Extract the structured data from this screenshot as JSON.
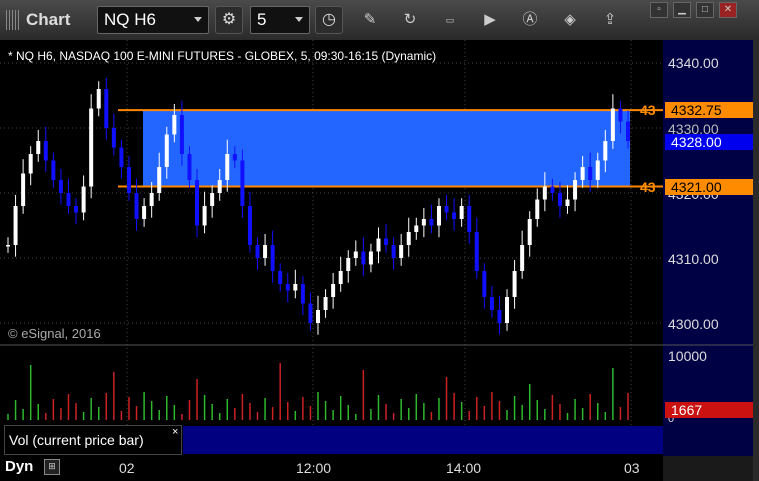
{
  "toolbar": {
    "title": "Chart",
    "symbol": "NQ H6",
    "interval": "5"
  },
  "chart_header": "* NQ H6, NASDAQ 100 E-MINI FUTURES - GLOBEX, 5, 09:30-16:15 (Dynamic)",
  "copyright": "© eSignal, 2016",
  "price_axis": {
    "ticks": [
      "4340.00",
      "4330.00",
      "4320.00",
      "4310.00",
      "4300.00"
    ],
    "hidden_tick": "4330.00"
  },
  "flags": {
    "upper_label": "4332.75",
    "current_label": "4328.00",
    "lower_label": "4321.00",
    "upper_marker": "43",
    "lower_marker": "43"
  },
  "volume_axis": {
    "tick_top": "10000",
    "tick_zero": "0",
    "current_label": "1667"
  },
  "volume_study_label": "Vol (current price bar)",
  "volume_close": "×",
  "time_axis": [
    "02",
    "12:00",
    "14:00",
    "03"
  ],
  "footer": {
    "dyn_label": "Dyn"
  },
  "colors": {
    "up_candle": "#ffffff",
    "down_candle": "#1010ff",
    "zone_fill": "#2266ff",
    "zone_line": "#ff8800",
    "vol_up": "#2db82d",
    "vol_down": "#cc2222"
  }
}
